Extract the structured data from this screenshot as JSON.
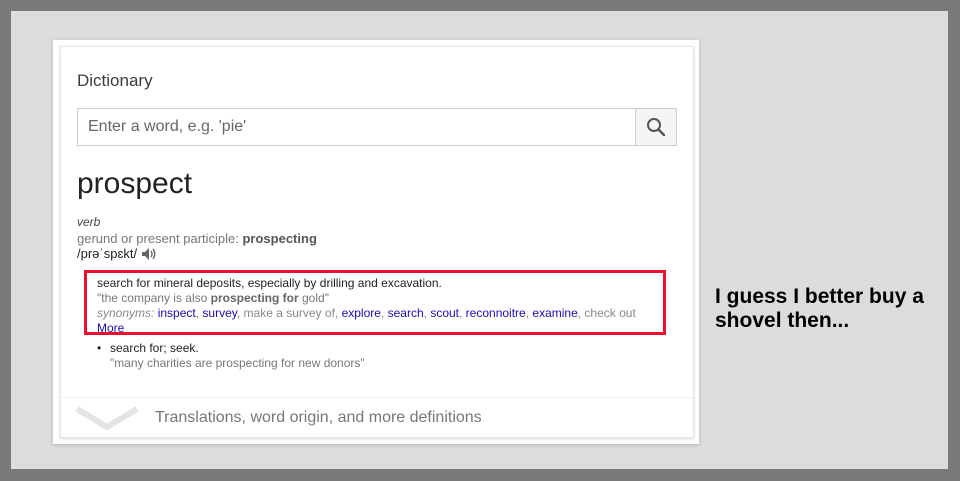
{
  "dictionary": {
    "title": "Dictionary",
    "search_placeholder": "Enter a word, e.g. 'pie'",
    "word": "prospect",
    "part_of_speech": "verb",
    "forms_label": "gerund or present participle: ",
    "forms_value": "prospecting",
    "phonetic": "/prəˈspɛkt/",
    "definition_1": {
      "text": "search for mineral deposits, especially by drilling and excavation.",
      "example_pre": "\"the company is also ",
      "example_bold": "prospecting for",
      "example_post": " gold\"",
      "synonyms_label": "synonyms:",
      "synonyms": [
        "inspect",
        "survey"
      ],
      "plain_syn": "make a survey of",
      "synonyms_b": [
        "explore",
        "search",
        "scout",
        "reconnoitre",
        "examine"
      ],
      "check_out": "check out",
      "more": "More"
    },
    "definition_2": {
      "text": "search for; seek.",
      "example": "\"many charities are prospecting for new donors\""
    },
    "footer": "Translations, word origin, and more definitions"
  },
  "caption": "I guess I better buy a shovel then...",
  "colors": {
    "highlight": "#e8102c",
    "link": "#1a0dab"
  },
  "icons": {
    "search": "search-icon",
    "speaker": "speaker-icon",
    "expand": "chevron-down-icon"
  }
}
